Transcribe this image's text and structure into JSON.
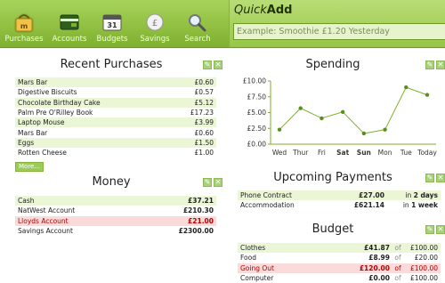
{
  "nav": {
    "purchases": "Purchases",
    "accounts": "Accounts",
    "budgets": "Budgets",
    "savings": "Savings",
    "search": "Search",
    "budgets_icon_text": "31"
  },
  "quickadd": {
    "title_prefix": "Quick",
    "title_suffix": "Add",
    "placeholder": "Example: Smoothie £1.20 Yesterday"
  },
  "recent": {
    "title": "Recent Purchases",
    "items": [
      {
        "name": "Mars Bar",
        "amount": "£0.60",
        "hl": true
      },
      {
        "name": "Digestive Biscuits",
        "amount": "£0.57",
        "hl": false
      },
      {
        "name": "Chocolate Birthday Cake",
        "amount": "£5.12",
        "hl": true
      },
      {
        "name": "Palm Pre O'Rilley Book",
        "amount": "£17.23",
        "hl": false
      },
      {
        "name": "Laptop Mouse",
        "amount": "£3.99",
        "hl": true
      },
      {
        "name": "Mars Bar",
        "amount": "£0.60",
        "hl": false
      },
      {
        "name": "Eggs",
        "amount": "£1.50",
        "hl": true
      },
      {
        "name": "Rotten Cheese",
        "amount": "£1.00",
        "hl": false
      }
    ],
    "more": "More..."
  },
  "money": {
    "title": "Money",
    "accounts": [
      {
        "name": "Cash",
        "amount": "£37.21",
        "style": "hl"
      },
      {
        "name": "NatWest Account",
        "amount": "£210.30",
        "style": ""
      },
      {
        "name": "Lloyds Account",
        "amount": "£21.00",
        "style": "red"
      },
      {
        "name": "Savings Account",
        "amount": "£2300.00",
        "style": ""
      }
    ]
  },
  "spending": {
    "title": "Spending"
  },
  "chart_data": {
    "type": "line",
    "categories": [
      "Wed",
      "Thur",
      "Fri",
      "Sat",
      "Sun",
      "Mon",
      "Tue",
      "Today"
    ],
    "bold_categories": [
      "Sat",
      "Sun"
    ],
    "values": [
      2.3,
      5.7,
      4.1,
      5.1,
      1.7,
      2.3,
      9.0,
      7.8
    ],
    "yticks": [
      "£0.00",
      "£2.50",
      "£5.00",
      "£7.50",
      "£10.00"
    ],
    "ylim": [
      0,
      10
    ],
    "color": "#7fb02f",
    "title": "",
    "xlabel": "",
    "ylabel": ""
  },
  "payments": {
    "title": "Upcoming Payments",
    "items": [
      {
        "name": "Phone Contract",
        "amount": "£27.00",
        "due_prefix": "in ",
        "due_bold": "2 days",
        "style": "hl"
      },
      {
        "name": "Accommodation",
        "amount": "£621.14",
        "due_prefix": "in ",
        "due_bold": "1 week",
        "style": ""
      }
    ]
  },
  "budget": {
    "title": "Budget",
    "of_label": "of",
    "items": [
      {
        "name": "Clothes",
        "amount": "£41.87",
        "limit": "£100.00",
        "style": "hl"
      },
      {
        "name": "Food",
        "amount": "£8.99",
        "limit": "£20.00",
        "style": ""
      },
      {
        "name": "Going Out",
        "amount": "£120.00",
        "limit": "£100.00",
        "style": "red"
      },
      {
        "name": "Computer",
        "amount": "£0.00",
        "limit": "£100.00",
        "style": ""
      }
    ]
  },
  "panel_controls": {
    "edit": "✎",
    "close": "✕"
  },
  "colors": {
    "accent": "#7fb02f",
    "highlight": "#eaf6d6",
    "over": "#fbdada",
    "overText": "#b00000"
  }
}
